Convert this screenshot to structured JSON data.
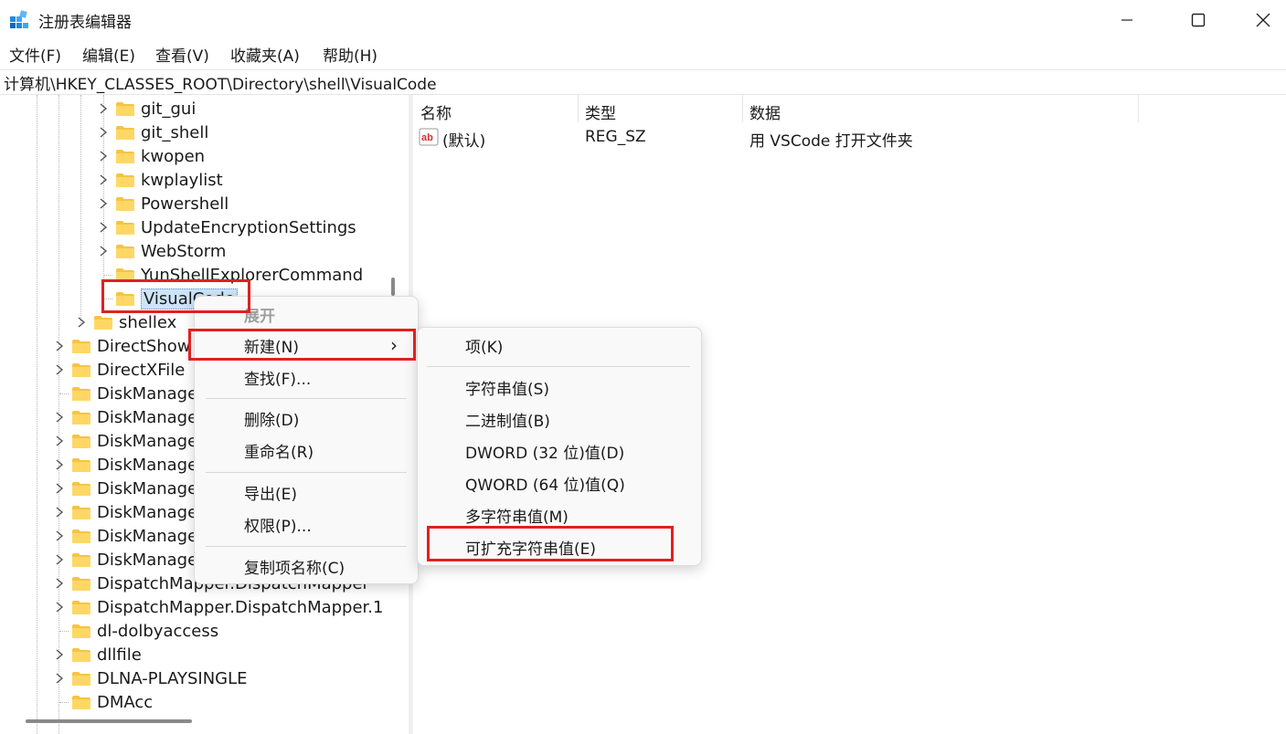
{
  "window": {
    "title": "注册表编辑器",
    "icon": "registry-editor-icon"
  },
  "menubar": [
    "文件(F)",
    "编辑(E)",
    "查看(V)",
    "收藏夹(A)",
    "帮助(H)"
  ],
  "address": "计算机\\HKEY_CLASSES_ROOT\\Directory\\shell\\VisualCode",
  "tree": {
    "items": [
      {
        "label": "git_gui",
        "expandable": true
      },
      {
        "label": "git_shell",
        "expandable": true
      },
      {
        "label": "kwopen",
        "expandable": true
      },
      {
        "label": "kwplaylist",
        "expandable": true
      },
      {
        "label": "Powershell",
        "expandable": true
      },
      {
        "label": "UpdateEncryptionSettings",
        "expandable": true
      },
      {
        "label": "WebStorm",
        "expandable": true
      },
      {
        "label": "YunShellExplorerCommand",
        "expandable": false
      },
      {
        "label": "VisualCode",
        "expandable": false,
        "selected": true
      },
      {
        "label": "shellex",
        "expandable": true
      },
      {
        "label": "DirectShow",
        "expandable": true
      },
      {
        "label": "DirectXFile",
        "expandable": true
      },
      {
        "label": "DiskManage",
        "expandable": false
      },
      {
        "label": "DiskManage",
        "expandable": true
      },
      {
        "label": "DiskManage",
        "expandable": true
      },
      {
        "label": "DiskManage",
        "expandable": true
      },
      {
        "label": "DiskManage",
        "expandable": true
      },
      {
        "label": "DiskManage",
        "expandable": true
      },
      {
        "label": "DiskManage",
        "expandable": true
      },
      {
        "label": "DiskManage",
        "expandable": true
      },
      {
        "label": "DispatchMapper.DispatchMapper",
        "expandable": true
      },
      {
        "label": "DispatchMapper.DispatchMapper.1",
        "expandable": true
      },
      {
        "label": "dl-dolbyaccess",
        "expandable": false
      },
      {
        "label": "dllfile",
        "expandable": true
      },
      {
        "label": "DLNA-PLAYSINGLE",
        "expandable": true
      },
      {
        "label": "DMAcc",
        "expandable": false
      }
    ]
  },
  "list": {
    "columns": [
      "名称",
      "类型",
      "数据"
    ],
    "rows": [
      {
        "name": "(默认)",
        "type": "REG_SZ",
        "data": "用 VSCode 打开文件夹",
        "icon": "string-value-icon"
      }
    ]
  },
  "context_menu": {
    "header": "展开",
    "items": [
      "新建(N)",
      "查找(F)...",
      "删除(D)",
      "重命名(R)",
      "导出(E)",
      "权限(P)...",
      "复制项名称(C)"
    ],
    "submenu_arrow": "›"
  },
  "submenu": {
    "items": [
      "项(K)",
      "字符串值(S)",
      "二进制值(B)",
      "DWORD (32 位)值(D)",
      "QWORD (64 位)值(Q)",
      "多字符串值(M)",
      "可扩充字符串值(E)"
    ]
  },
  "colors": {
    "highlight": "#e02020",
    "folder": "#f6c443",
    "selection": "#cce4f7"
  }
}
